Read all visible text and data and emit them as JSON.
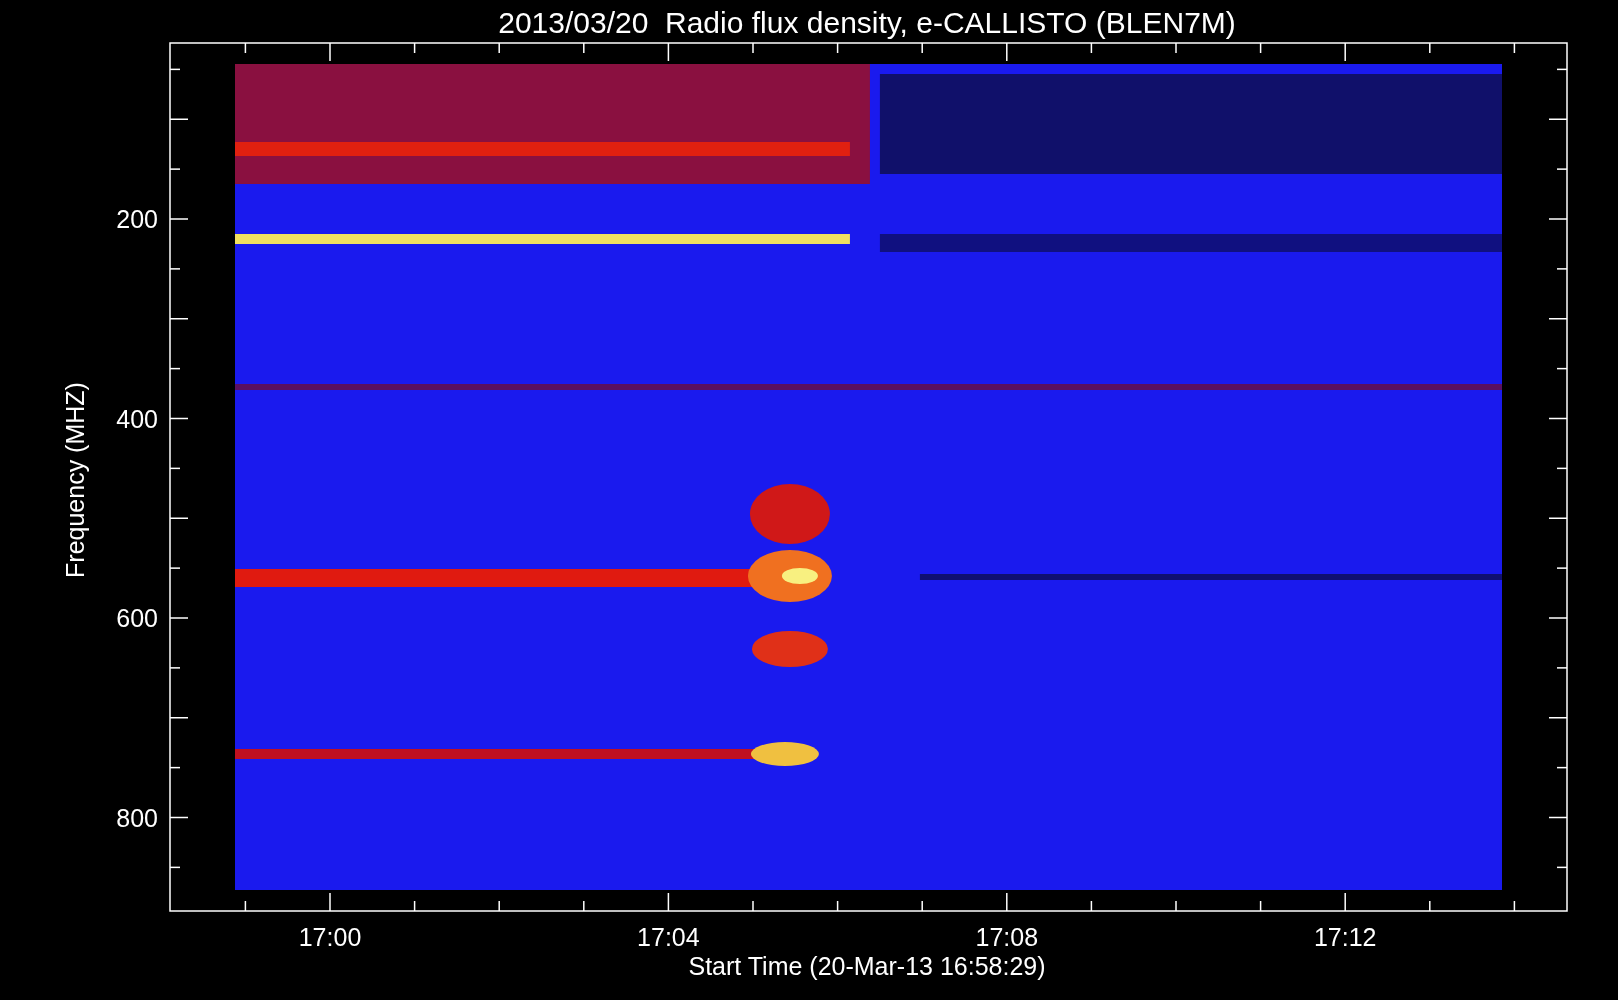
{
  "title": "2013/03/20  Radio flux density, e-CALLISTO (BLEN7M)",
  "y_axis": {
    "label": "Frequency (MHZ)",
    "ticks": [
      "200",
      "400",
      "600",
      "800"
    ]
  },
  "x_axis": {
    "label": "Start Time (20-Mar-13 16:58:29)",
    "ticks": [
      "17:00",
      "17:04",
      "17:08",
      "17:12"
    ]
  }
}
